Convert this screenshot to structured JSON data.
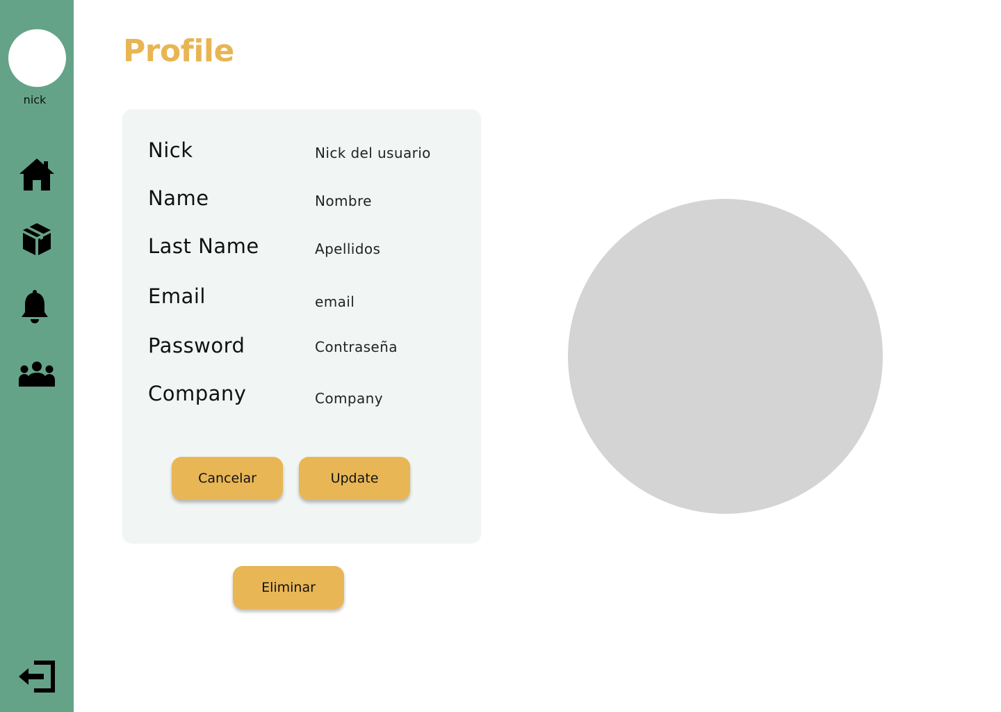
{
  "sidebar": {
    "user_name": "nick",
    "items": [
      {
        "icon": "home-icon"
      },
      {
        "icon": "box-icon"
      },
      {
        "icon": "bell-icon"
      },
      {
        "icon": "team-icon"
      }
    ],
    "logout_icon": "logout-icon"
  },
  "page": {
    "title": "Profile"
  },
  "form": {
    "fields": [
      {
        "label": "Nick",
        "value": "Nick del usuario"
      },
      {
        "label": "Name",
        "value": "Nombre"
      },
      {
        "label": "Last Name",
        "value": "Apellidos"
      },
      {
        "label": "Email",
        "value": "email"
      },
      {
        "label": "Password",
        "value": "Contraseña"
      },
      {
        "label": "Company",
        "value": "Company"
      }
    ],
    "cancel_label": "Cancelar",
    "update_label": "Update"
  },
  "delete_label": "Eliminar",
  "colors": {
    "sidebar": "#65a388",
    "accent": "#e9b656",
    "card": "#f1f6f4",
    "image_placeholder": "#d4d4d4"
  }
}
